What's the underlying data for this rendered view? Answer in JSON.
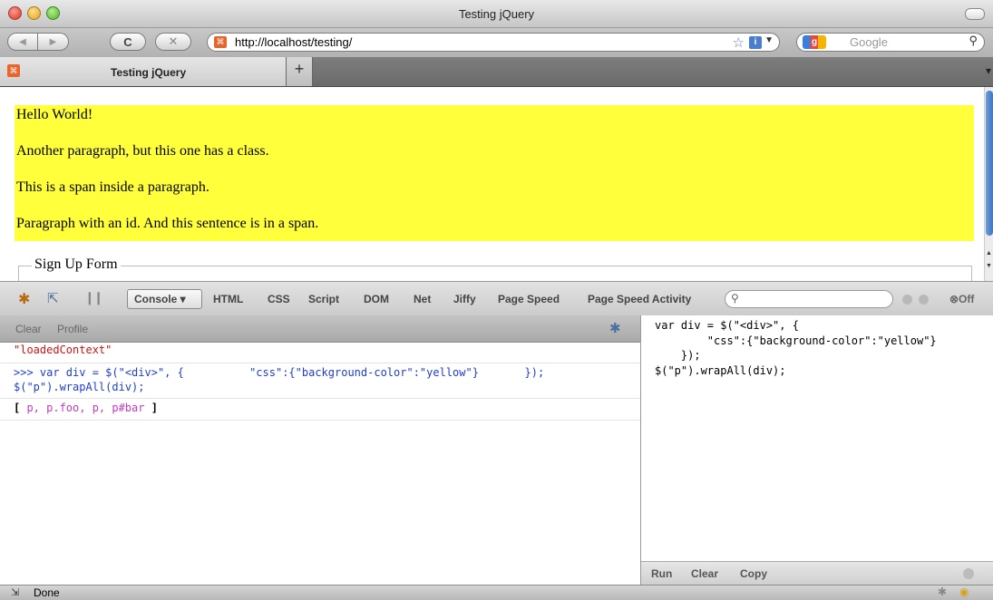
{
  "window": {
    "title": "Testing jQuery"
  },
  "toolbar": {
    "back_icon": "◀",
    "forward_icon": "▶",
    "reload_icon": "C",
    "stop_icon": "✕",
    "url": "http://localhost/testing/",
    "search_placeholder": "Google"
  },
  "tabs": [
    {
      "label": "Testing jQuery",
      "active": true
    }
  ],
  "page": {
    "paragraphs": [
      "Hello World!",
      "Another paragraph, but this one has a class.",
      "This is a span inside a paragraph.",
      "Paragraph with an id. And this sentence is in a span."
    ],
    "wrap_background": "#ffff3c",
    "fieldset_legend": "Sign Up Form"
  },
  "firebug": {
    "tabs": [
      "Console ▾",
      "HTML",
      "CSS",
      "Script",
      "DOM",
      "Net",
      "Jiffy",
      "Page Speed",
      "Page Speed Activity"
    ],
    "off_label": "⊗Off",
    "console_toolbar": {
      "clear": "Clear",
      "profile": "Profile"
    },
    "console_rows": {
      "row1": "\"loadedContext\"",
      "row2_line1": ">>> var div = $(\"<div>\", {          \"css\":{\"background-color\":\"yellow\"}       });",
      "row2_line2": "$(\"p\").wrapAll(div);",
      "row3_open": "[",
      "row3_items": " p, p.foo, p, p#bar ",
      "row3_close": "]"
    },
    "editor": {
      "code": "var div = $(\"<div>\", {\n        \"css\":{\"background-color\":\"yellow\"}\n    });\n$(\"p\").wrapAll(div);",
      "buttons": {
        "run": "Run",
        "clear": "Clear",
        "copy": "Copy"
      }
    }
  },
  "status": {
    "text": "Done"
  },
  "colors": {
    "error_red": "#d21414",
    "command_blue": "#1f3ed1",
    "object_magenta": "#c03cc2"
  }
}
